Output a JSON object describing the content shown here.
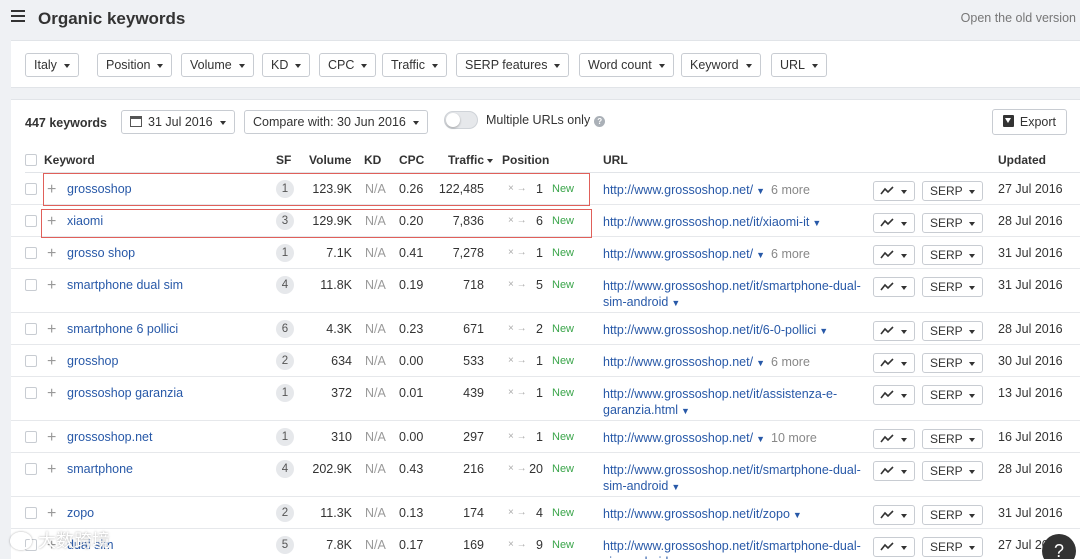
{
  "header": {
    "title": "Organic keywords",
    "old_version": "Open the old version"
  },
  "filters": [
    "Italy",
    "Position",
    "Volume",
    "KD",
    "CPC",
    "Traffic",
    "SERP features",
    "Word count",
    "Keyword",
    "URL"
  ],
  "toolbar": {
    "count": "447 keywords",
    "date": "31 Jul 2016",
    "compare": "Compare with: 30 Jun 2016",
    "toggle_label": "Multiple URLs only",
    "toggle_on": false,
    "export": "Export"
  },
  "columns": {
    "keyword": "Keyword",
    "sf": "SF",
    "volume": "Volume",
    "kd": "KD",
    "cpc": "CPC",
    "traffic": "Traffic",
    "position": "Position",
    "url": "URL",
    "updated": "Updated"
  },
  "rows": [
    {
      "keyword": "grossoshop",
      "sf": "1",
      "volume": "123.9K",
      "kd": "N/A",
      "cpc": "0.26",
      "traffic": "122,485",
      "arrow": "× →",
      "position": "1",
      "badge": "New",
      "url": "http://www.grossoshop.net/",
      "more": "6 more",
      "serp": "SERP",
      "updated": "27 Jul 2016"
    },
    {
      "keyword": "xiaomi",
      "sf": "3",
      "volume": "129.9K",
      "kd": "N/A",
      "cpc": "0.20",
      "traffic": "7,836",
      "arrow": "× →",
      "position": "6",
      "badge": "New",
      "url": "http://www.grossoshop.net/it/xiaomi-it",
      "more": "",
      "serp": "SERP",
      "updated": "28 Jul 2016"
    },
    {
      "keyword": "grosso shop",
      "sf": "1",
      "volume": "7.1K",
      "kd": "N/A",
      "cpc": "0.41",
      "traffic": "7,278",
      "arrow": "× →",
      "position": "1",
      "badge": "New",
      "url": "http://www.grossoshop.net/",
      "more": "6 more",
      "serp": "SERP",
      "updated": "31 Jul 2016"
    },
    {
      "keyword": "smartphone dual sim",
      "sf": "4",
      "volume": "11.8K",
      "kd": "N/A",
      "cpc": "0.19",
      "traffic": "718",
      "arrow": "× →",
      "position": "5",
      "badge": "New",
      "url": "http://www.grossoshop.net/it/smartphone-dual-sim-android",
      "more": "",
      "serp": "SERP",
      "updated": "31 Jul 2016"
    },
    {
      "keyword": "smartphone 6 pollici",
      "sf": "6",
      "volume": "4.3K",
      "kd": "N/A",
      "cpc": "0.23",
      "traffic": "671",
      "arrow": "× →",
      "position": "2",
      "badge": "New",
      "url": "http://www.grossoshop.net/it/6-0-pollici",
      "more": "",
      "serp": "SERP",
      "updated": "28 Jul 2016"
    },
    {
      "keyword": "grosshop",
      "sf": "2",
      "volume": "634",
      "kd": "N/A",
      "cpc": "0.00",
      "traffic": "533",
      "arrow": "× →",
      "position": "1",
      "badge": "New",
      "url": "http://www.grossoshop.net/",
      "more": "6 more",
      "serp": "SERP",
      "updated": "30 Jul 2016"
    },
    {
      "keyword": "grossoshop garanzia",
      "sf": "1",
      "volume": "372",
      "kd": "N/A",
      "cpc": "0.01",
      "traffic": "439",
      "arrow": "× →",
      "position": "1",
      "badge": "New",
      "url": "http://www.grossoshop.net/it/assistenza-e-garanzia.html",
      "more": "",
      "serp": "SERP",
      "updated": "13 Jul 2016"
    },
    {
      "keyword": "grossoshop.net",
      "sf": "1",
      "volume": "310",
      "kd": "N/A",
      "cpc": "0.00",
      "traffic": "297",
      "arrow": "× →",
      "position": "1",
      "badge": "New",
      "url": "http://www.grossoshop.net/",
      "more": "10 more",
      "serp": "SERP",
      "updated": "16 Jul 2016"
    },
    {
      "keyword": "smartphone",
      "sf": "4",
      "volume": "202.9K",
      "kd": "N/A",
      "cpc": "0.43",
      "traffic": "216",
      "arrow": "× →",
      "position": "20",
      "badge": "New",
      "url": "http://www.grossoshop.net/it/smartphone-dual-sim-android",
      "more": "",
      "serp": "SERP",
      "updated": "28 Jul 2016"
    },
    {
      "keyword": "zopo",
      "sf": "2",
      "volume": "11.3K",
      "kd": "N/A",
      "cpc": "0.13",
      "traffic": "174",
      "arrow": "× →",
      "position": "4",
      "badge": "New",
      "url": "http://www.grossoshop.net/it/zopo",
      "more": "",
      "serp": "SERP",
      "updated": "31 Jul 2016"
    },
    {
      "keyword": "dual sim",
      "sf": "5",
      "volume": "7.8K",
      "kd": "N/A",
      "cpc": "0.17",
      "traffic": "169",
      "arrow": "× →",
      "position": "9",
      "badge": "New",
      "url": "http://www.grossoshop.net/it/smartphone-dual-sim-android",
      "more": "",
      "serp": "SERP",
      "updated": "27 Jul 2016"
    }
  ],
  "watermark": "大数跨境",
  "help": "?"
}
